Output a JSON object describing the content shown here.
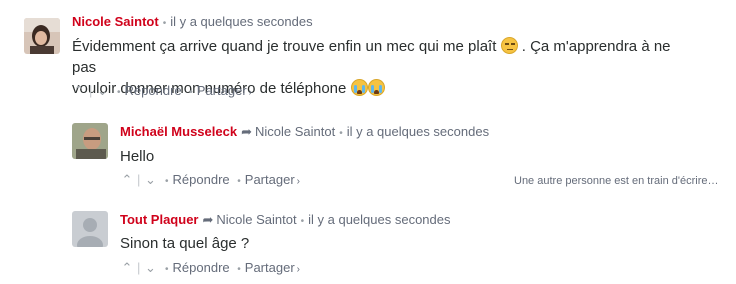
{
  "comments": [
    {
      "author": "Nicole Saintot",
      "reply_to": "",
      "time": "il y a quelques secondes",
      "text_line1_part1": "Évidemment ça arrive quand je trouve enfin un mec qui me plaît",
      "text_line1_part2": " . Ça m'apprendra à ne pas",
      "text_line2": "vouloir donner mon numéro de téléphone",
      "avatar": "photo-avatar"
    },
    {
      "author": "Michaël Musseleck",
      "reply_to": "Nicole Saintot",
      "time": "il y a quelques secondes",
      "text": "Hello",
      "avatar": "photo-avatar"
    },
    {
      "author": "Tout Plaquer",
      "reply_to": "Nicole Saintot",
      "time": "il y a quelques secondes",
      "text": "Sinon ta quel âge ?",
      "avatar": "default-avatar"
    }
  ],
  "actions": {
    "reply": "Répondre",
    "share": "Partager",
    "share_chevron": "›",
    "dot": "•",
    "upvote": "⌃",
    "downvote": "⌄",
    "separator": "|"
  },
  "typing_indicator": "Une autre personne est en train d'écrire…",
  "colors": {
    "author": "#d0021b",
    "muted": "#656c7a",
    "text": "#2a2e2e"
  }
}
